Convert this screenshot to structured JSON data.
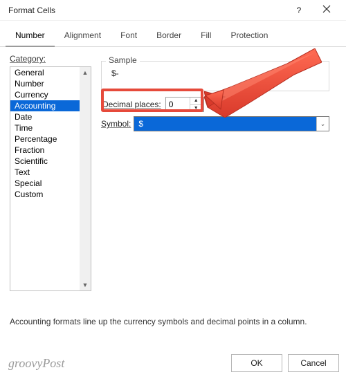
{
  "window": {
    "title": "Format Cells",
    "help_tooltip": "?",
    "close_tooltip": "Close"
  },
  "tabs": [
    {
      "label": "Number",
      "active": true
    },
    {
      "label": "Alignment",
      "active": false
    },
    {
      "label": "Font",
      "active": false
    },
    {
      "label": "Border",
      "active": false
    },
    {
      "label": "Fill",
      "active": false
    },
    {
      "label": "Protection",
      "active": false
    }
  ],
  "category": {
    "label": "Category:",
    "items": [
      "General",
      "Number",
      "Currency",
      "Accounting",
      "Date",
      "Time",
      "Percentage",
      "Fraction",
      "Scientific",
      "Text",
      "Special",
      "Custom"
    ],
    "selected_index": 3
  },
  "sample": {
    "label": "Sample",
    "value": "$-"
  },
  "decimal": {
    "label": "Decimal places:",
    "value": "0"
  },
  "symbol": {
    "label": "Symbol:",
    "value": "$"
  },
  "description": "Accounting formats line up the currency symbols and decimal points in a column.",
  "buttons": {
    "ok": "OK",
    "cancel": "Cancel"
  },
  "watermark": "groovyPost"
}
